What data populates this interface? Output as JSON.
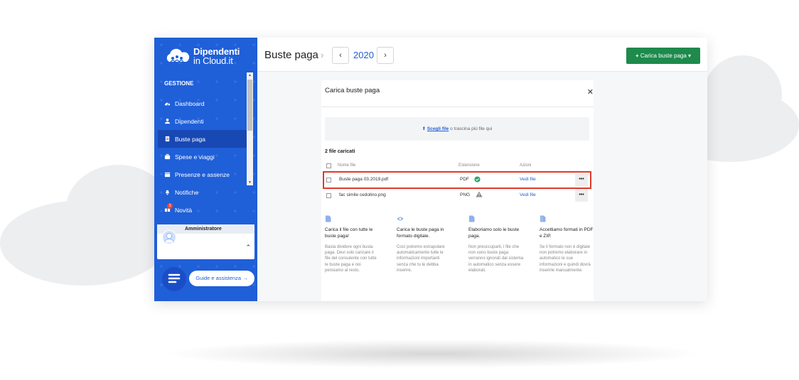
{
  "app": {
    "logo_line1": "Dipendenti",
    "logo_line2": "in Cloud.it"
  },
  "sidebar": {
    "section_title": "GESTIONE",
    "items": [
      {
        "label": "Dashboard",
        "icon": "dashboard-icon",
        "active": false
      },
      {
        "label": "Dipendenti",
        "icon": "users-icon",
        "active": false
      },
      {
        "label": "Buste paga",
        "icon": "document-icon",
        "active": true
      },
      {
        "label": "Spese e viaggi",
        "icon": "briefcase-icon",
        "active": false
      },
      {
        "label": "Presenze e assenze",
        "icon": "calendar-icon",
        "active": false
      },
      {
        "label": "Notifiche",
        "icon": "bell-icon",
        "active": false
      },
      {
        "label": "Novità",
        "icon": "gift-icon",
        "active": false,
        "badge": "3"
      }
    ],
    "admin_label": "Amministratore",
    "guide_label": "Guide e assistenza →"
  },
  "header": {
    "title": "Buste paga",
    "year": "2020",
    "upload_button": "Carica buste paga"
  },
  "modal": {
    "title": "Carica buste paga",
    "dropzone_link": "Scegli file",
    "dropzone_text": " o trascina più file qui",
    "files_count": "2 file caricati",
    "columns": {
      "name": "Nome file",
      "extension": "Estensione",
      "actions": "Azioni"
    },
    "files": [
      {
        "name": "Buste paga 03.2019.pdf",
        "ext": "PDF",
        "status": "ok",
        "action": "Vedi file",
        "highlighted": true
      },
      {
        "name": "fac simile cedolino.png",
        "ext": "PNG",
        "status": "warning",
        "action": "Vedi file",
        "highlighted": false
      }
    ],
    "tips": [
      {
        "icon": "document-icon",
        "title": "Carica il file con tutte le buste paga!",
        "body": "Basta dividere ogni busta paga. Devi solo caricare il file del consulente con tutte le buste paga e noi pensiamo al resto."
      },
      {
        "icon": "eye-icon",
        "title": "Carica le buste paga in formato digitale.",
        "body": "Così potremo estrapolare automaticamente tutte le informazioni importanti senza che tu le debba inserire."
      },
      {
        "icon": "document-icon",
        "title": "Elaboriamo solo le buste paga.",
        "body": "Non preoccuparti, i file che non sono buste paga verranno ignorati dal sistema in automatico senza essere elaborati."
      },
      {
        "icon": "file-zip-icon",
        "title": "Accettiamo formati in PDF e ZIP.",
        "body": "Se il formato non è digitale non potremo elaborare in automatico le sue informazioni e quindi dovrà inserirle manualmente."
      }
    ]
  },
  "colors": {
    "sidebar": "#1f5fd8",
    "active_item": "#1848b4",
    "upload_button": "#1e8a4c",
    "highlight": "#e03a2a",
    "link": "#1f5fd8"
  }
}
